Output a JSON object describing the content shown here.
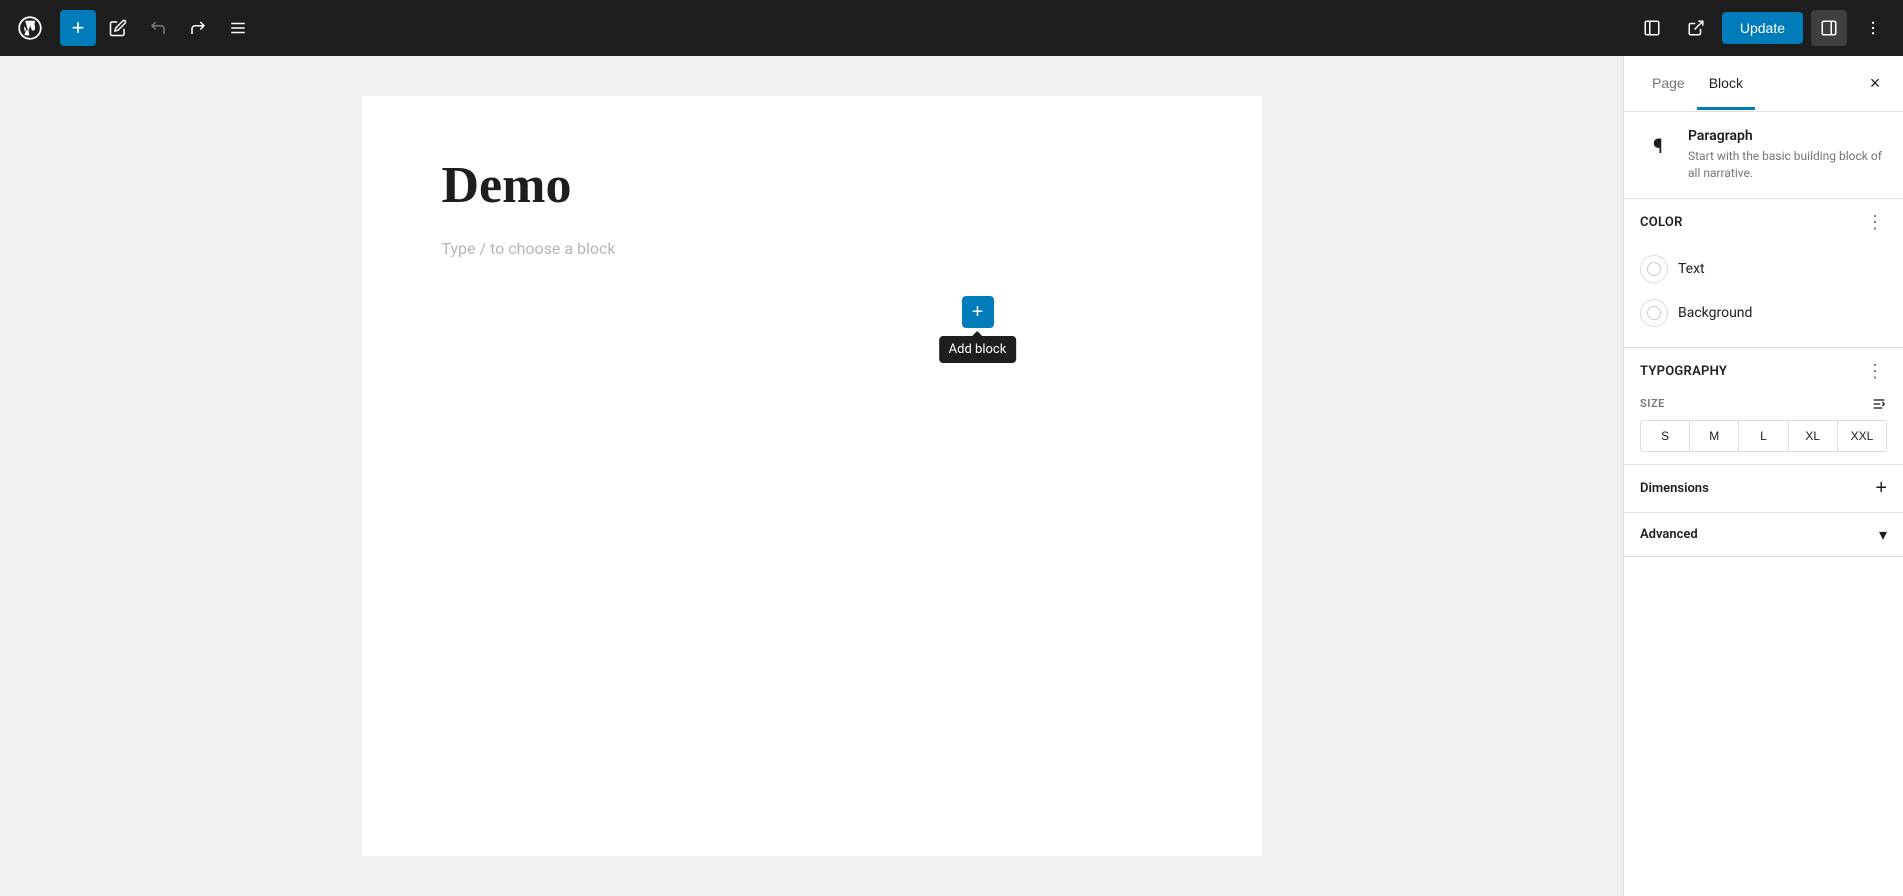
{
  "toolbar": {
    "add_label": "+",
    "update_label": "Update",
    "undo_icon": "↩",
    "redo_icon": "↪",
    "menu_icon": "≡",
    "view_icon": "view",
    "external_icon": "external",
    "sidebar_icon": "sidebar",
    "more_icon": "⋮"
  },
  "editor": {
    "page_title": "Demo",
    "block_placeholder": "Type / to choose a block",
    "add_block_tooltip": "Add block"
  },
  "sidebar": {
    "tabs": [
      {
        "label": "Page",
        "active": false
      },
      {
        "label": "Block",
        "active": true
      }
    ],
    "close_label": "×",
    "block_info": {
      "icon": "¶",
      "name": "Paragraph",
      "description": "Start with the basic building block of all narrative."
    },
    "color_section": {
      "title": "Color",
      "more_icon": "⋮",
      "options": [
        {
          "label": "Text"
        },
        {
          "label": "Background"
        }
      ]
    },
    "typography_section": {
      "title": "Typography",
      "more_icon": "⋮",
      "size_label": "SIZE",
      "size_options": [
        "S",
        "M",
        "L",
        "XL",
        "XXL"
      ]
    },
    "dimensions_section": {
      "title": "Dimensions",
      "add_icon": "+"
    },
    "advanced_section": {
      "title": "Advanced",
      "chevron_icon": "▾"
    }
  }
}
